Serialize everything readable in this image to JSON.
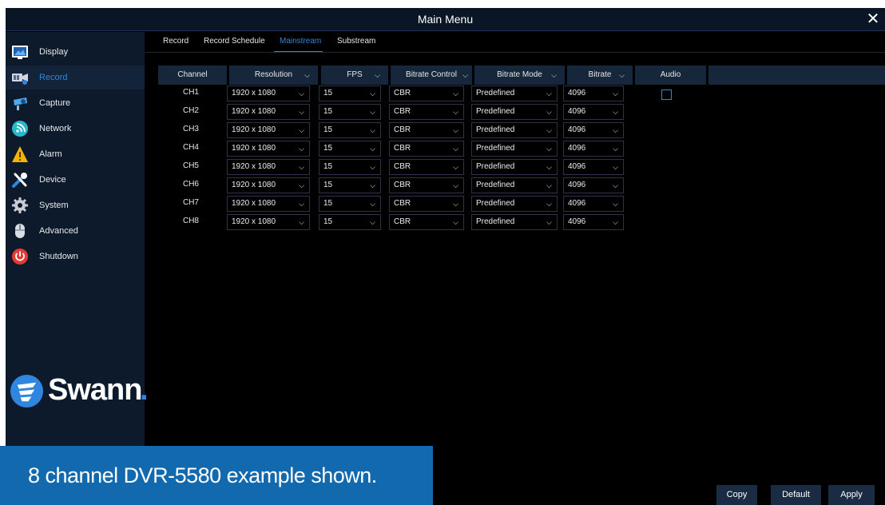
{
  "window": {
    "title": "Main Menu",
    "close_glyph": "✕"
  },
  "sidebar": {
    "items": [
      {
        "label": "Display",
        "icon": "display-icon"
      },
      {
        "label": "Record",
        "icon": "record-icon",
        "active": true
      },
      {
        "label": "Capture",
        "icon": "capture-icon"
      },
      {
        "label": "Network",
        "icon": "network-icon"
      },
      {
        "label": "Alarm",
        "icon": "alarm-icon"
      },
      {
        "label": "Device",
        "icon": "device-icon"
      },
      {
        "label": "System",
        "icon": "system-icon"
      },
      {
        "label": "Advanced",
        "icon": "advanced-icon"
      },
      {
        "label": "Shutdown",
        "icon": "shutdown-icon"
      }
    ],
    "logo_text": "Swann",
    "logo_mark": "."
  },
  "tabs": [
    {
      "label": "Record"
    },
    {
      "label": "Record Schedule"
    },
    {
      "label": "Mainstream",
      "active": true
    },
    {
      "label": "Substream"
    }
  ],
  "table": {
    "headers": {
      "channel": "Channel",
      "resolution": "Resolution",
      "fps": "FPS",
      "bitrate_control": "Bitrate Control",
      "bitrate_mode": "Bitrate Mode",
      "bitrate": "Bitrate",
      "audio": "Audio"
    },
    "rows": [
      {
        "channel": "CH1",
        "resolution": "1920 x 1080",
        "fps": "15",
        "bitrate_control": "CBR",
        "bitrate_mode": "Predefined",
        "bitrate": "4096",
        "audio": false
      },
      {
        "channel": "CH2",
        "resolution": "1920 x 1080",
        "fps": "15",
        "bitrate_control": "CBR",
        "bitrate_mode": "Predefined",
        "bitrate": "4096"
      },
      {
        "channel": "CH3",
        "resolution": "1920 x 1080",
        "fps": "15",
        "bitrate_control": "CBR",
        "bitrate_mode": "Predefined",
        "bitrate": "4096"
      },
      {
        "channel": "CH4",
        "resolution": "1920 x 1080",
        "fps": "15",
        "bitrate_control": "CBR",
        "bitrate_mode": "Predefined",
        "bitrate": "4096"
      },
      {
        "channel": "CH5",
        "resolution": "1920 x 1080",
        "fps": "15",
        "bitrate_control": "CBR",
        "bitrate_mode": "Predefined",
        "bitrate": "4096"
      },
      {
        "channel": "CH6",
        "resolution": "1920 x 1080",
        "fps": "15",
        "bitrate_control": "CBR",
        "bitrate_mode": "Predefined",
        "bitrate": "4096"
      },
      {
        "channel": "CH7",
        "resolution": "1920 x 1080",
        "fps": "15",
        "bitrate_control": "CBR",
        "bitrate_mode": "Predefined",
        "bitrate": "4096"
      },
      {
        "channel": "CH8",
        "resolution": "1920 x 1080",
        "fps": "15",
        "bitrate_control": "CBR",
        "bitrate_mode": "Predefined",
        "bitrate": "4096"
      }
    ]
  },
  "caption": "8 channel DVR-5580 example shown.",
  "buttons": {
    "copy": "Copy",
    "default": "Default",
    "apply": "Apply"
  },
  "colors": {
    "accent": "#2f86de",
    "caption_bg": "#1269ae",
    "sidebar_bg": "#0c1a2c",
    "header_bg": "#16273c"
  }
}
